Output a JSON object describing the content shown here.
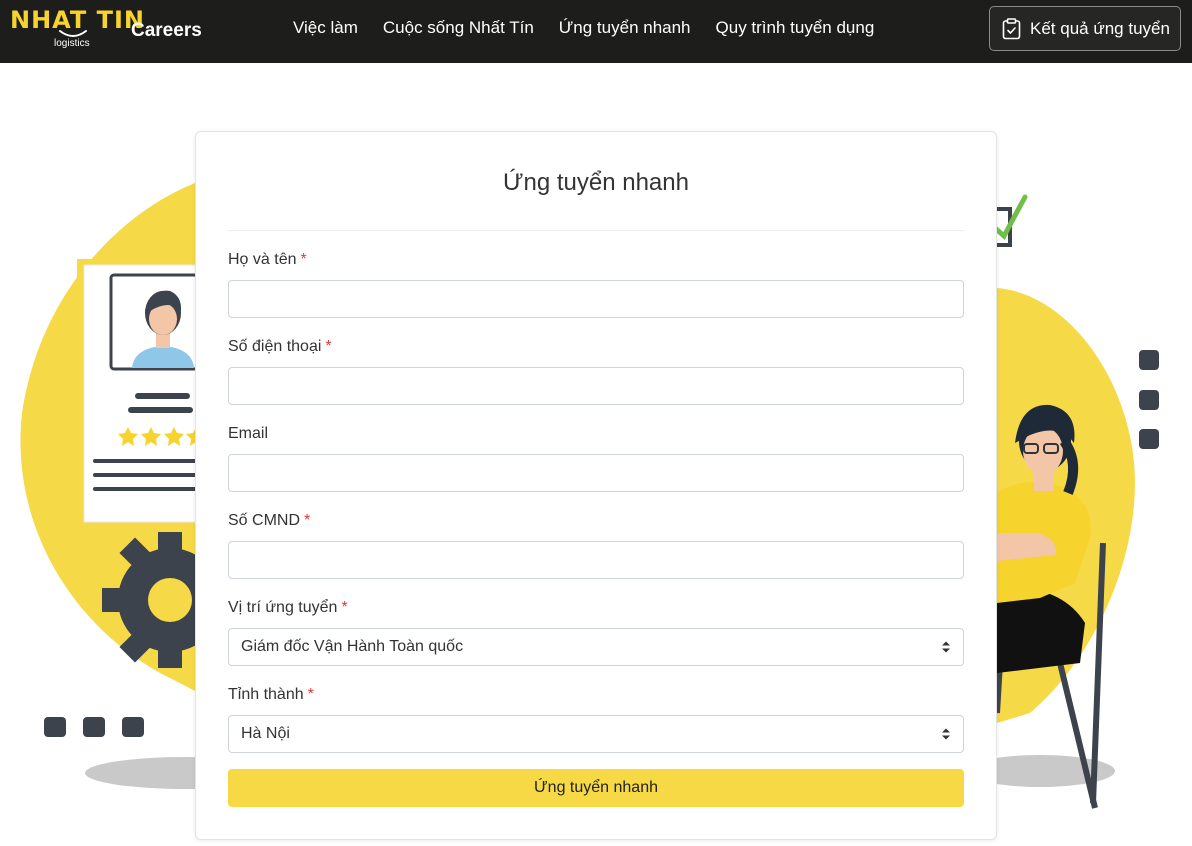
{
  "header": {
    "logo_text": "NHAT TIN",
    "logo_sub": "logistics",
    "brand": "Careers",
    "nav": [
      "Việc làm",
      "Cuộc sống Nhất Tín",
      "Ứng tuyển nhanh",
      "Quy trình tuyển dụng"
    ],
    "result_button": "Kết quả ứng tuyển"
  },
  "form": {
    "title": "Ứng tuyển nhanh",
    "required_mark": "*",
    "fields": {
      "fullname": {
        "label": "Họ và tên",
        "value": ""
      },
      "phone": {
        "label": "Số điện thoại",
        "value": ""
      },
      "email": {
        "label": "Email",
        "value": ""
      },
      "id_number": {
        "label": "Số CMND",
        "value": ""
      },
      "position": {
        "label": "Vị trí ứng tuyển",
        "value": "Giám đốc Vận Hành Toàn quốc"
      },
      "province": {
        "label": "Tỉnh thành",
        "value": "Hà Nội"
      }
    },
    "submit": "Ứng tuyển nhanh"
  },
  "colors": {
    "navbar": "#1d1d1b",
    "accent_yellow": "#f6d32d",
    "button_yellow": "#f6d944",
    "required_red": "#e53935"
  },
  "icons": [
    "clipboard-check-icon",
    "select-arrows-icon",
    "gear-icon",
    "star-icon"
  ]
}
